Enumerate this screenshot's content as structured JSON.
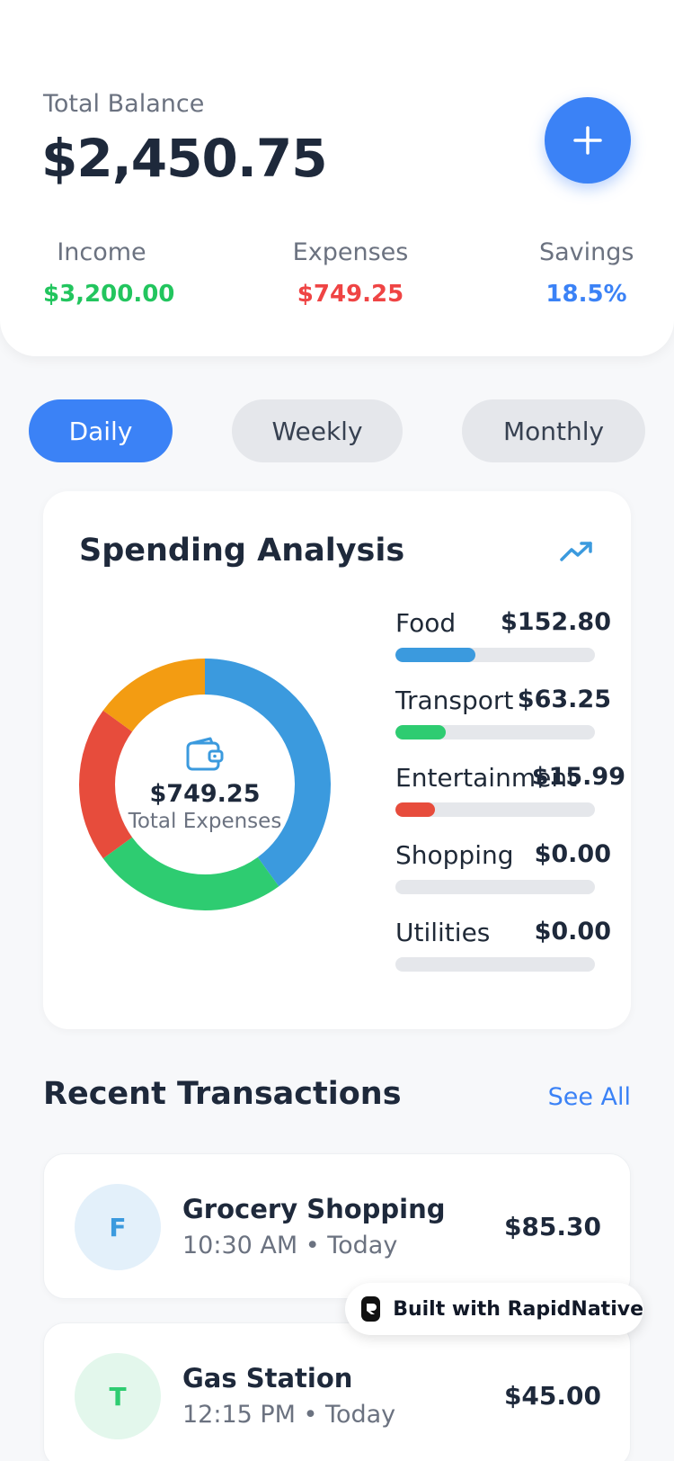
{
  "header": {
    "balance_label": "Total Balance",
    "balance_value": "$2,450.75",
    "add_icon": "plus-icon",
    "stats": [
      {
        "label": "Income",
        "value": "$3,200.00",
        "color": "#22c55e"
      },
      {
        "label": "Expenses",
        "value": "$749.25",
        "color": "#ef4444"
      },
      {
        "label": "Savings",
        "value": "18.5%",
        "color": "#3b82f6"
      }
    ]
  },
  "tabs": [
    {
      "label": "Daily",
      "active": true
    },
    {
      "label": "Weekly",
      "active": false
    },
    {
      "label": "Monthly",
      "active": false
    }
  ],
  "spending": {
    "title": "Spending Analysis",
    "trend_icon": "trending-up-icon",
    "center_icon": "wallet-icon",
    "total": "$749.25",
    "total_caption": "Total Expenses",
    "categories": [
      {
        "name": "Food",
        "amount": "$152.80",
        "fill_fraction": 0.4,
        "color": "#3b9ade"
      },
      {
        "name": "Transport",
        "amount": "$63.25",
        "fill_fraction": 0.25,
        "color": "#2ecc71"
      },
      {
        "name": "Entertainment",
        "amount": "$15.99",
        "fill_fraction": 0.2,
        "color": "#e74c3c"
      },
      {
        "name": "Shopping",
        "amount": "$0.00",
        "fill_fraction": 0,
        "color": "#f39c12"
      },
      {
        "name": "Utilities",
        "amount": "$0.00",
        "fill_fraction": 0,
        "color": "#9b59b6"
      }
    ],
    "donut_segments": [
      {
        "name": "blue",
        "value": 40,
        "color": "#3b9ade"
      },
      {
        "name": "green",
        "value": 25,
        "color": "#2ecc71"
      },
      {
        "name": "red",
        "value": 20,
        "color": "#e74c3c"
      },
      {
        "name": "orange",
        "value": 15,
        "color": "#f39c12"
      }
    ]
  },
  "transactions": {
    "title": "Recent Transactions",
    "see_all": "See All",
    "items": [
      {
        "initial": "F",
        "name": "Grocery Shopping",
        "time": "10:30 AM • Today",
        "amount": "$85.30",
        "avatar_bg": "#e3f0fa",
        "avatar_fg": "#3b9ade"
      },
      {
        "initial": "T",
        "name": "Gas Station",
        "time": "12:15 PM • Today",
        "amount": "$45.00",
        "avatar_bg": "#e3f7ec",
        "avatar_fg": "#2ecc71"
      }
    ]
  },
  "badge": {
    "text": "Built with RapidNative",
    "logo_icon": "rapidnative-logo-icon"
  }
}
